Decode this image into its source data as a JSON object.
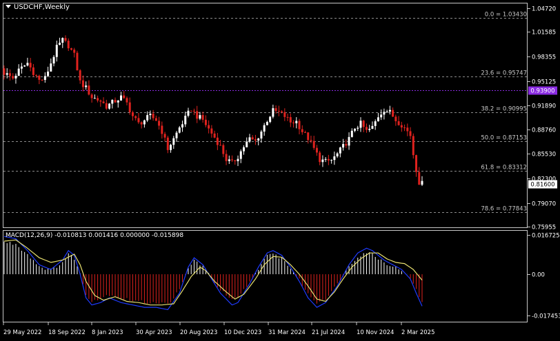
{
  "window": {
    "symbol_title": "USDCHF,Weekly",
    "macd_label": "MACD(12,26,9) -0.010813 0.001416 0.000000 -0.015898"
  },
  "colors": {
    "background": "#000000",
    "bull_candle": "#ffffff",
    "bear_candle": "#e0221e",
    "fib_line": "#8c8c8c",
    "current_price_box": "#ffffff",
    "highlight_price_line": "#8a2be2",
    "macd_line": "#1f3bff",
    "signal_line": "#e8e070",
    "hist_positive": "#ffffff",
    "hist_negative": "#e0221e"
  },
  "chart_data": [
    {
      "type": "candlestick",
      "title": "USDCHF,Weekly",
      "ylim": [
        0.7595,
        1.0525
      ],
      "y_ticks": [
        1.0472,
        1.01585,
        0.98355,
        0.95125,
        0.9189,
        0.8876,
        0.8553,
        0.823,
        0.7907,
        0.75955
      ],
      "y_tick_labels": [
        "1.04720",
        "1.01585",
        "0.98355",
        "0.95125",
        "0.91890",
        "0.88760",
        "0.85530",
        "0.82300",
        "0.79070",
        "0.75955"
      ],
      "x_tick_labels": [
        "29 May 2022",
        "18 Sep 2022",
        "8 Jan 2023",
        "30 Apr 2023",
        "20 Aug 2023",
        "10 Dec 2023",
        "31 Mar 2024",
        "21 Jul 2024",
        "10 Nov 2024",
        "2 Mar 2025"
      ],
      "highlight_price": {
        "label": "0.93900",
        "value": 0.939
      },
      "current_price": {
        "label": "0.81600",
        "value": 0.816
      },
      "fibonacci_levels": [
        {
          "label": "0.0 = 1.03430",
          "value": 1.0343
        },
        {
          "label": "23.6 = 0.95747",
          "value": 0.95747
        },
        {
          "label": "38.2 = 0.90995",
          "value": 0.90995
        },
        {
          "label": "50.0 = 0.87153",
          "value": 0.87153
        },
        {
          "label": "61.8 = 0.83312",
          "value": 0.83312
        },
        {
          "label": "78.6 = 0.77843",
          "value": 0.77843
        }
      ],
      "close_path": [
        [
          0,
          0.962
        ],
        [
          3,
          0.955
        ],
        [
          5,
          0.965
        ],
        [
          8,
          0.975
        ],
        [
          10,
          0.963
        ],
        [
          12,
          0.952
        ],
        [
          14,
          0.955
        ],
        [
          16,
          0.975
        ],
        [
          18,
          0.995
        ],
        [
          20,
          1.005
        ],
        [
          22,
          0.998
        ],
        [
          24,
          0.985
        ],
        [
          26,
          0.95
        ],
        [
          28,
          0.942
        ],
        [
          30,
          0.93
        ],
        [
          33,
          0.925
        ],
        [
          35,
          0.918
        ],
        [
          38,
          0.925
        ],
        [
          40,
          0.93
        ],
        [
          42,
          0.922
        ],
        [
          44,
          0.905
        ],
        [
          46,
          0.895
        ],
        [
          48,
          0.9
        ],
        [
          50,
          0.905
        ],
        [
          52,
          0.9
        ],
        [
          54,
          0.885
        ],
        [
          56,
          0.862
        ],
        [
          58,
          0.875
        ],
        [
          60,
          0.89
        ],
        [
          62,
          0.902
        ],
        [
          64,
          0.915
        ],
        [
          66,
          0.905
        ],
        [
          68,
          0.9
        ],
        [
          70,
          0.888
        ],
        [
          72,
          0.877
        ],
        [
          74,
          0.865
        ],
        [
          76,
          0.848
        ],
        [
          78,
          0.843
        ],
        [
          80,
          0.852
        ],
        [
          82,
          0.865
        ],
        [
          84,
          0.875
        ],
        [
          86,
          0.872
        ],
        [
          88,
          0.885
        ],
        [
          90,
          0.9
        ],
        [
          92,
          0.912
        ],
        [
          94,
          0.91
        ],
        [
          96,
          0.905
        ],
        [
          98,
          0.897
        ],
        [
          100,
          0.898
        ],
        [
          102,
          0.885
        ],
        [
          104,
          0.876
        ],
        [
          106,
          0.862
        ],
        [
          108,
          0.848
        ],
        [
          110,
          0.845
        ],
        [
          112,
          0.847
        ],
        [
          114,
          0.855
        ],
        [
          116,
          0.865
        ],
        [
          118,
          0.875
        ],
        [
          120,
          0.89
        ],
        [
          122,
          0.895
        ],
        [
          124,
          0.885
        ],
        [
          126,
          0.89
        ],
        [
          128,
          0.905
        ],
        [
          130,
          0.914
        ],
        [
          132,
          0.91
        ],
        [
          134,
          0.9
        ],
        [
          136,
          0.894
        ],
        [
          138,
          0.885
        ],
        [
          139,
          0.88
        ],
        [
          140,
          0.855
        ],
        [
          141,
          0.835
        ],
        [
          142,
          0.818
        ],
        [
          143,
          0.816
        ]
      ]
    },
    {
      "type": "macd",
      "title": "MACD(12,26,9)",
      "ylim": [
        -0.0198,
        0.0178
      ],
      "y_ticks": [
        0.016725,
        0.0,
        -0.017453
      ],
      "y_tick_labels": [
        "0.016725",
        "0.00",
        "-0.017453"
      ],
      "macd_path": [
        [
          0,
          0.016
        ],
        [
          4,
          0.015
        ],
        [
          8,
          0.01
        ],
        [
          12,
          0.004
        ],
        [
          16,
          0.002
        ],
        [
          20,
          0.006
        ],
        [
          22,
          0.01
        ],
        [
          24,
          0.008
        ],
        [
          26,
          0.0
        ],
        [
          28,
          -0.01
        ],
        [
          30,
          -0.013
        ],
        [
          33,
          -0.012
        ],
        [
          36,
          -0.01
        ],
        [
          40,
          -0.012
        ],
        [
          44,
          -0.013
        ],
        [
          48,
          -0.014
        ],
        [
          52,
          -0.014
        ],
        [
          56,
          -0.015
        ],
        [
          60,
          -0.008
        ],
        [
          63,
          0.003
        ],
        [
          65,
          0.007
        ],
        [
          68,
          0.004
        ],
        [
          70,
          0.0
        ],
        [
          74,
          -0.008
        ],
        [
          78,
          -0.013
        ],
        [
          80,
          -0.012
        ],
        [
          84,
          -0.004
        ],
        [
          87,
          0.003
        ],
        [
          90,
          0.009
        ],
        [
          92,
          0.01
        ],
        [
          95,
          0.008
        ],
        [
          98,
          0.003
        ],
        [
          101,
          -0.003
        ],
        [
          104,
          -0.01
        ],
        [
          107,
          -0.014
        ],
        [
          110,
          -0.012
        ],
        [
          114,
          -0.005
        ],
        [
          118,
          0.004
        ],
        [
          121,
          0.009
        ],
        [
          124,
          0.011
        ],
        [
          126,
          0.01
        ],
        [
          128,
          0.008
        ],
        [
          130,
          0.006
        ],
        [
          133,
          0.004
        ],
        [
          136,
          0.002
        ],
        [
          139,
          -0.002
        ],
        [
          141,
          -0.008
        ],
        [
          143,
          -0.0135
        ]
      ],
      "signal_path": [
        [
          0,
          0.014
        ],
        [
          4,
          0.0145
        ],
        [
          8,
          0.011
        ],
        [
          12,
          0.007
        ],
        [
          16,
          0.005
        ],
        [
          20,
          0.006
        ],
        [
          24,
          0.0085
        ],
        [
          26,
          0.004
        ],
        [
          28,
          -0.003
        ],
        [
          31,
          -0.009
        ],
        [
          34,
          -0.011
        ],
        [
          38,
          -0.0095
        ],
        [
          42,
          -0.0115
        ],
        [
          46,
          -0.012
        ],
        [
          50,
          -0.013
        ],
        [
          54,
          -0.013
        ],
        [
          58,
          -0.0125
        ],
        [
          61,
          -0.007
        ],
        [
          64,
          -0.001
        ],
        [
          67,
          0.003
        ],
        [
          69,
          0.0015
        ],
        [
          72,
          -0.003
        ],
        [
          76,
          -0.0075
        ],
        [
          79,
          -0.0105
        ],
        [
          82,
          -0.0085
        ],
        [
          86,
          -0.002
        ],
        [
          89,
          0.004
        ],
        [
          92,
          0.0075
        ],
        [
          95,
          0.0072
        ],
        [
          98,
          0.004
        ],
        [
          101,
          0.0
        ],
        [
          104,
          -0.005
        ],
        [
          107,
          -0.0105
        ],
        [
          110,
          -0.0115
        ],
        [
          113,
          -0.0075
        ],
        [
          116,
          -0.002
        ],
        [
          119,
          0.003
        ],
        [
          122,
          0.0065
        ],
        [
          125,
          0.009
        ],
        [
          128,
          0.009
        ],
        [
          131,
          0.0065
        ],
        [
          134,
          0.005
        ],
        [
          137,
          0.0045
        ],
        [
          140,
          0.002
        ],
        [
          143,
          -0.0025
        ]
      ]
    }
  ]
}
